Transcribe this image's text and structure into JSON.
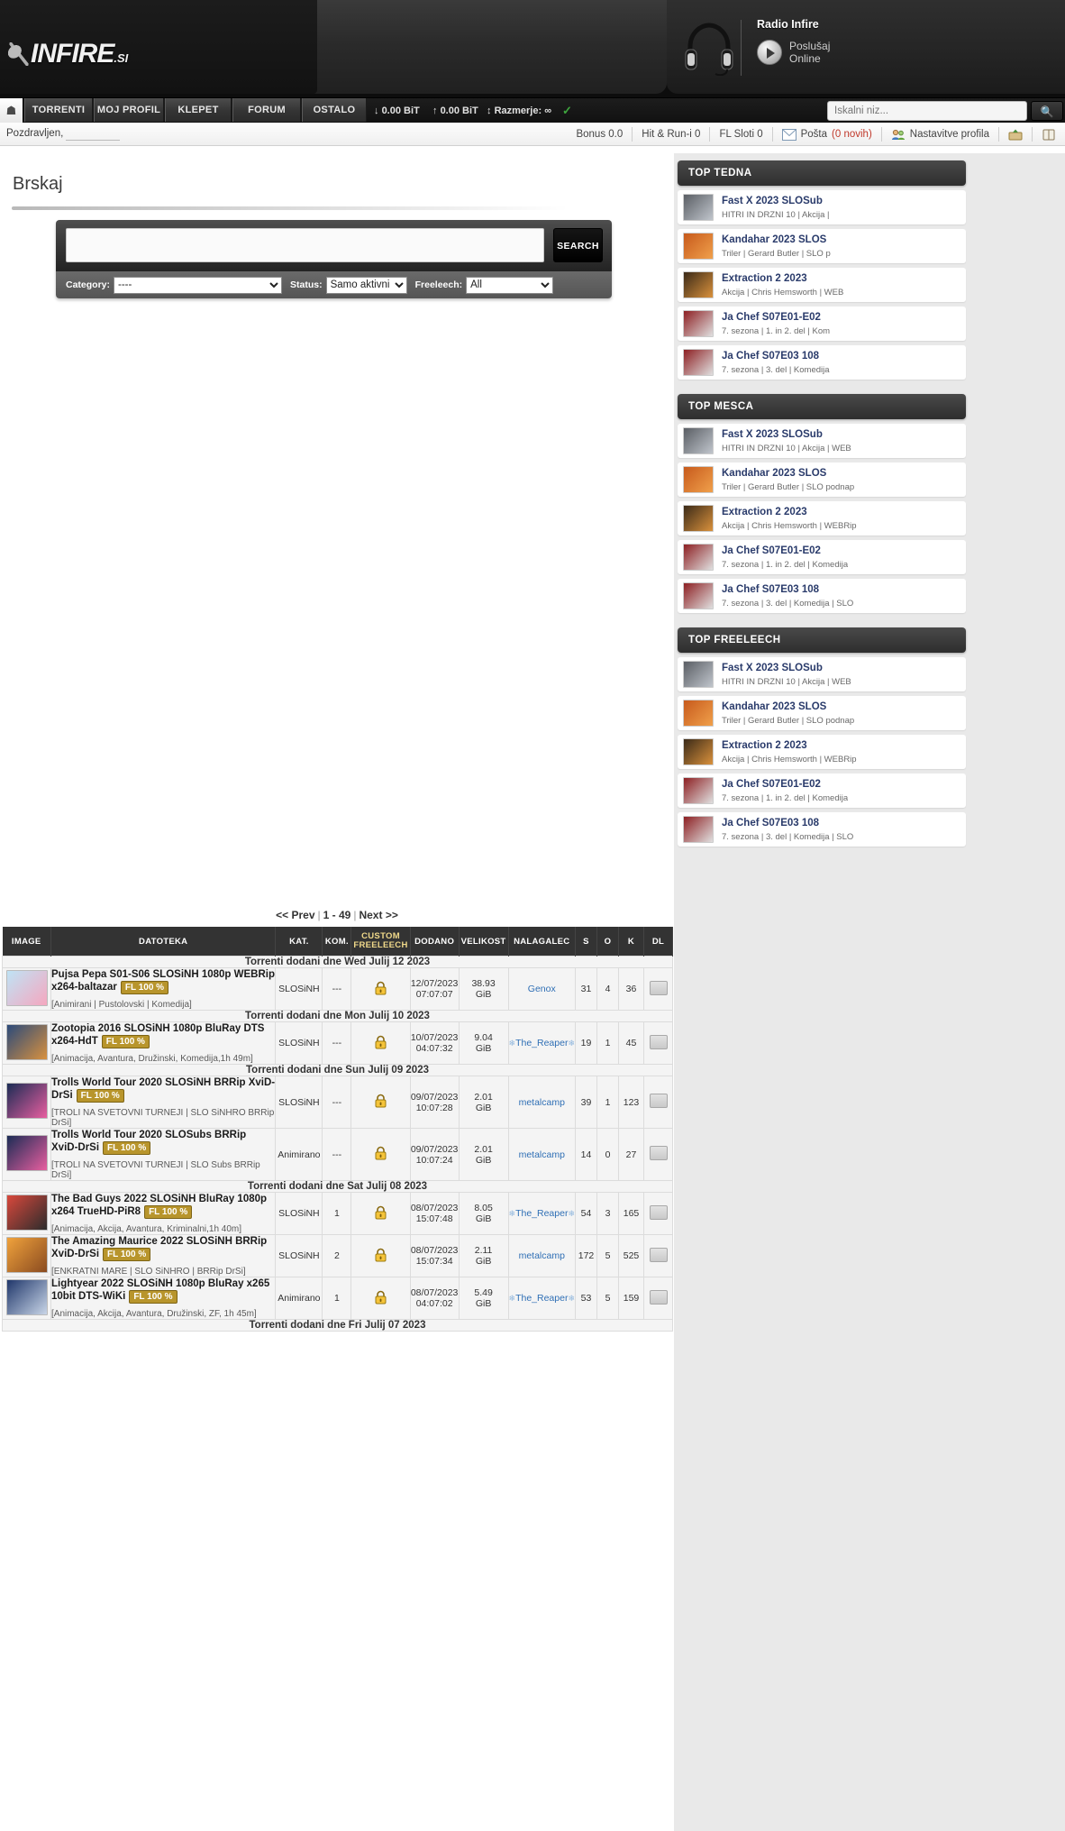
{
  "site": {
    "logo_text": "INFIRE",
    "logo_suffix": ".SI"
  },
  "radio": {
    "title": "Radio Infire",
    "listen_label": "Poslušaj",
    "online_label": "Online",
    "headphones_icon": "headphones-icon",
    "play_icon": "play-icon"
  },
  "nav": {
    "home_icon": "home-icon",
    "items": [
      {
        "label": "TORRENTI"
      },
      {
        "label": "MOJ PROFIL"
      },
      {
        "label": "KLEPET"
      },
      {
        "label": "FORUM"
      },
      {
        "label": "OSTALO"
      }
    ],
    "stats": {
      "download": "0.00 BiT",
      "upload": "0.00 BiT",
      "ratio": "Razmerje: ∞",
      "download_icon": "arrow-down-icon",
      "upload_icon": "arrow-up-icon",
      "ratio_icon": "up-down-arrow-icon",
      "status_icon": "check-icon"
    },
    "search_placeholder": "Iskalni niz...",
    "search_value": "",
    "search_button_icon": "search-icon"
  },
  "subbar": {
    "greeting": "Pozdravljen,",
    "username": "",
    "cells": [
      {
        "label": "Bonus 0.0",
        "icon": null
      },
      {
        "label": "Hit & Run-i 0",
        "icon": null
      },
      {
        "label": "FL Sloti 0",
        "icon": null
      },
      {
        "label": "Pošta ",
        "badge": "(0 novih)",
        "icon": "envelope-icon"
      },
      {
        "label": "Nastavitve profila",
        "icon": "users-icon"
      },
      {
        "label": "",
        "icon": "upload-icon"
      },
      {
        "label": "",
        "icon": "book-icon"
      }
    ]
  },
  "page": {
    "title": "Brskaj"
  },
  "search_panel": {
    "query_value": "",
    "query_placeholder": "",
    "search_button": "SEARCH",
    "filters": [
      {
        "label": "Category:",
        "value": "----",
        "name": "category"
      },
      {
        "label": "Status:",
        "value": "Samo aktivni",
        "name": "status"
      },
      {
        "label": "Freeleech:",
        "value": "All",
        "name": "freeleech"
      }
    ]
  },
  "pagination": {
    "prev": "<< Prev",
    "range": "1 - 49",
    "next": "Next >>"
  },
  "table": {
    "headers": [
      "IMAGE",
      "DATOTEKA",
      "KAT.",
      "KOM.",
      "CUSTOM FREELEECH",
      "DODANO",
      "VELIKOST",
      "NALAGALEC",
      "S",
      "O",
      "K",
      "DL"
    ],
    "headers_split": {
      "fl_line1": "CUSTOM",
      "fl_line2": "FREELEECH"
    },
    "groups": [
      {
        "date_label": "Torrenti dodani dne Wed Julij 12 2023",
        "rows": [
          {
            "name": "Pujsa Pepa S01-S06 SLOSiNH 1080p WEBRip x264-baltazar",
            "fl_badge": "FL 100 %",
            "desc": "[Animirani | Pustolovski | Komedija]",
            "kat": "SLOSiNH",
            "kom": "---",
            "lock_icon": "lock-icon",
            "dodano_date": "12/07/2023",
            "dodano_time": "07:07:07",
            "velikost_num": "38.93",
            "velikost_unit": "GiB",
            "uploader": "Genox",
            "s": "31",
            "o": "4",
            "k": "36",
            "dl_icon": "download-icon",
            "poster_colors": [
              "#bfe3f5",
              "#f5a7bf"
            ]
          }
        ]
      },
      {
        "date_label": "Torrenti dodani dne Mon Julij 10 2023",
        "rows": [
          {
            "name": "Zootopia 2016 SLOSiNH 1080p BluRay DTS x264-HdT",
            "fl_badge": "FL 100 %",
            "desc": "[Animacija, Avantura, Družinski, Komedija,1h 49m]",
            "kat": "SLOSiNH",
            "kom": "---",
            "lock_icon": "lock-icon",
            "dodano_date": "10/07/2023",
            "dodano_time": "04:07:32",
            "velikost_num": "9.04",
            "velikost_unit": "GiB",
            "uploader": "The_Reaper",
            "uploader_prefix": "snowflake-icon",
            "s": "19",
            "o": "1",
            "k": "45",
            "dl_icon": "download-icon",
            "poster_colors": [
              "#2b4a7a",
              "#d8913f"
            ]
          }
        ]
      },
      {
        "date_label": "Torrenti dodani dne Sun Julij 09 2023",
        "rows": [
          {
            "name": "Trolls World Tour 2020 SLOSiNH BRRip XviD-DrSi",
            "fl_badge": "FL 100 %",
            "desc": "[TROLI NA SVETOVNI TURNEJI | SLO SiNHRO BRRip DrSi]",
            "kat": "SLOSiNH",
            "kom": "---",
            "lock_icon": "lock-icon",
            "dodano_date": "09/07/2023",
            "dodano_time": "10:07:28",
            "velikost_num": "2.01",
            "velikost_unit": "GiB",
            "uploader": "metalcamp",
            "s": "39",
            "o": "1",
            "k": "123",
            "dl_icon": "download-icon",
            "poster_colors": [
              "#1b2c55",
              "#e85fa0"
            ]
          },
          {
            "name": "Trolls World Tour 2020 SLOSubs BRRip XviD-DrSi",
            "fl_badge": "FL 100 %",
            "desc": "[TROLI NA SVETOVNI TURNEJI | SLO Subs BRRip DrSi]",
            "kat": "Animirano",
            "kom": "---",
            "lock_icon": "lock-icon",
            "dodano_date": "09/07/2023",
            "dodano_time": "10:07:24",
            "velikost_num": "2.01",
            "velikost_unit": "GiB",
            "uploader": "metalcamp",
            "s": "14",
            "o": "0",
            "k": "27",
            "dl_icon": "download-icon",
            "poster_colors": [
              "#1b2c55",
              "#e85fa0"
            ]
          }
        ]
      },
      {
        "date_label": "Torrenti dodani dne Sat Julij 08 2023",
        "rows": [
          {
            "name": "The Bad Guys 2022 SLOSiNH BluRay 1080p x264 TrueHD-PiR8",
            "fl_badge": "FL 100 %",
            "desc": "[Animacija, Akcija, Avantura, Kriminalni,1h 40m]",
            "kat": "SLOSiNH",
            "kom": "1",
            "lock_icon": "lock-icon",
            "dodano_date": "08/07/2023",
            "dodano_time": "15:07:48",
            "velikost_num": "8.05",
            "velikost_unit": "GiB",
            "uploader": "The_Reaper",
            "uploader_prefix": "snowflake-icon",
            "s": "54",
            "o": "3",
            "k": "165",
            "dl_icon": "download-icon",
            "poster_colors": [
              "#d9483c",
              "#2c2c2c"
            ]
          },
          {
            "name": "The Amazing Maurice 2022 SLOSiNH BRRip XviD-DrSi",
            "fl_badge": "FL 100 %",
            "desc": "[ENKRATNI MARE | SLO SiNHRO | BRRip DrSi]",
            "kat": "SLOSiNH",
            "kom": "2",
            "lock_icon": "lock-icon",
            "dodano_date": "08/07/2023",
            "dodano_time": "15:07:34",
            "velikost_num": "2.11",
            "velikost_unit": "GiB",
            "uploader": "metalcamp",
            "s": "172",
            "o": "5",
            "k": "525",
            "dl_icon": "download-icon",
            "poster_colors": [
              "#f0a23c",
              "#8a4b20"
            ]
          },
          {
            "name": "Lightyear 2022 SLOSiNH 1080p BluRay x265 10bit DTS-WiKi",
            "fl_badge": "FL 100 %",
            "desc": "[Animacija, Akcija, Avantura, Družinski, ZF, 1h 45m]",
            "kat": "Animirano",
            "kom": "1",
            "lock_icon": "lock-icon",
            "dodano_date": "08/07/2023",
            "dodano_time": "04:07:02",
            "velikost_num": "5.49",
            "velikost_unit": "GiB",
            "uploader": "The_Reaper",
            "uploader_prefix": "snowflake-icon",
            "s": "53",
            "o": "5",
            "k": "159",
            "dl_icon": "download-icon",
            "poster_colors": [
              "#20376b",
              "#c9d6e8"
            ]
          }
        ]
      },
      {
        "date_label": "Torrenti dodani dne Fri Julij 07 2023",
        "rows": []
      }
    ]
  },
  "sidebar": {
    "boxes": [
      {
        "title": "TOP TEDNA",
        "items": [
          {
            "title": "Fast X 2023 SLOSub",
            "meta": "HITRI IN DRZNI 10 | Akcija |",
            "colors": [
              "#5a5e64",
              "#c0c5cc"
            ]
          },
          {
            "title": "Kandahar 2023 SLOS",
            "meta": "Triler | Gerard Butler | SLO p",
            "colors": [
              "#c75a1c",
              "#f0a04b"
            ]
          },
          {
            "title": "Extraction 2 2023",
            "meta": "Akcija | Chris Hemsworth | WEB",
            "colors": [
              "#3a2a18",
              "#d9913c"
            ]
          },
          {
            "title": "Ja Chef S07E01-E02",
            "meta": "7. sezona | 1. in 2. del | Kom",
            "colors": [
              "#8d1f22",
              "#e0e0e0"
            ]
          },
          {
            "title": "Ja Chef S07E03 108",
            "meta": "7. sezona | 3. del | Komedija",
            "colors": [
              "#8d1f22",
              "#e0e0e0"
            ]
          }
        ]
      },
      {
        "title": "TOP MESCA",
        "items": [
          {
            "title": "Fast X 2023 SLOSub",
            "meta": "HITRI IN DRZNI 10 | Akcija | WEB",
            "colors": [
              "#5a5e64",
              "#c0c5cc"
            ]
          },
          {
            "title": "Kandahar 2023 SLOS",
            "meta": "Triler | Gerard Butler | SLO podnap",
            "colors": [
              "#c75a1c",
              "#f0a04b"
            ]
          },
          {
            "title": "Extraction 2 2023",
            "meta": "Akcija | Chris Hemsworth | WEBRip",
            "colors": [
              "#3a2a18",
              "#d9913c"
            ]
          },
          {
            "title": "Ja Chef S07E01-E02",
            "meta": "7. sezona | 1. in 2. del | Komedija",
            "colors": [
              "#8d1f22",
              "#e0e0e0"
            ]
          },
          {
            "title": "Ja Chef S07E03 108",
            "meta": "7. sezona | 3. del | Komedija | SLO",
            "colors": [
              "#8d1f22",
              "#e0e0e0"
            ]
          }
        ]
      },
      {
        "title": "TOP FREELEECH",
        "items": [
          {
            "title": "Fast X 2023 SLOSub",
            "meta": "HITRI IN DRZNI 10 | Akcija | WEB",
            "colors": [
              "#5a5e64",
              "#c0c5cc"
            ]
          },
          {
            "title": "Kandahar 2023 SLOS",
            "meta": "Triler | Gerard Butler | SLO podnap",
            "colors": [
              "#c75a1c",
              "#f0a04b"
            ]
          },
          {
            "title": "Extraction 2 2023",
            "meta": "Akcija | Chris Hemsworth | WEBRip",
            "colors": [
              "#3a2a18",
              "#d9913c"
            ]
          },
          {
            "title": "Ja Chef S07E01-E02",
            "meta": "7. sezona | 1. in 2. del | Komedija",
            "colors": [
              "#8d1f22",
              "#e0e0e0"
            ]
          },
          {
            "title": "Ja Chef S07E03 108",
            "meta": "7. sezona | 3. del | Komedija | SLO",
            "colors": [
              "#8d1f22",
              "#e0e0e0"
            ]
          }
        ]
      }
    ]
  },
  "colors": {
    "nav_bg": "#1d1d1d",
    "header_bg": "#2b2b2b",
    "table_header_bg": "#333333",
    "fl_badge": "#b8952c",
    "link": "#2f6fb5",
    "sidebar_title": "#2a3b6b",
    "check_green": "#3ea63e"
  }
}
